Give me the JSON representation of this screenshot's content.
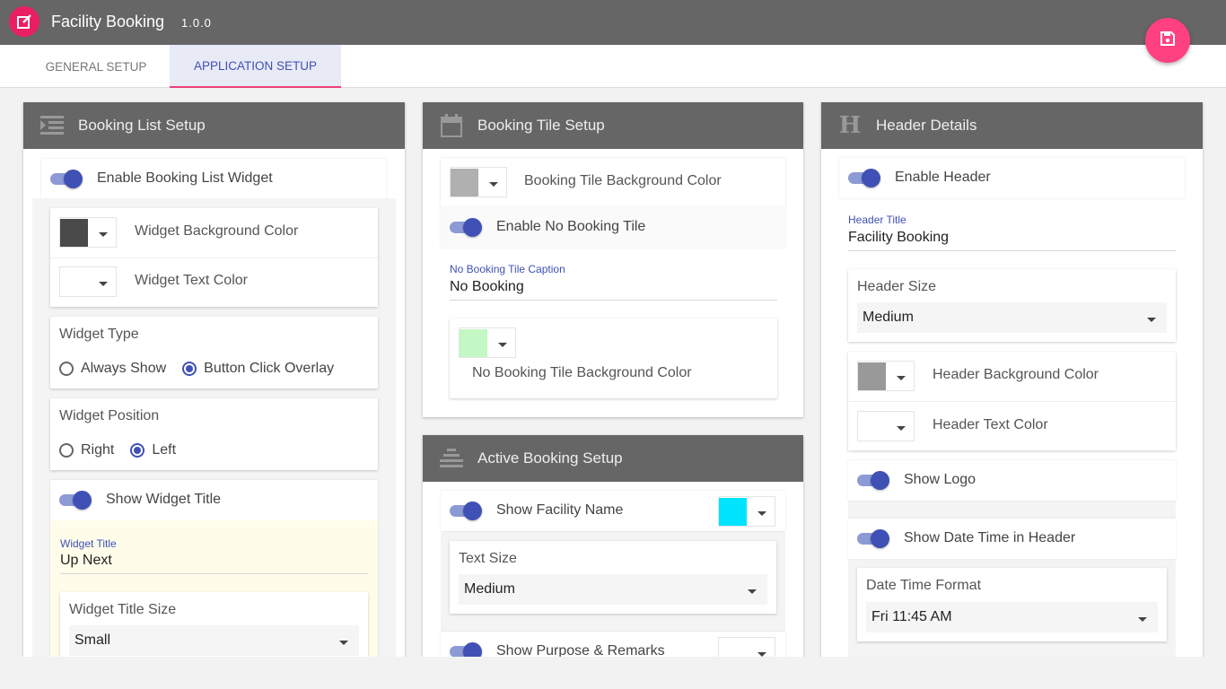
{
  "app": {
    "title": "Facility Booking",
    "version": "1.0.0",
    "logo_icon": "edit-square-icon",
    "save_icon": "save-icon"
  },
  "colors": {
    "appbar": "#666666",
    "accent": "#3f51b5",
    "fab": "#ff4081",
    "tab_indicator": "#ec407a"
  },
  "tabs": [
    {
      "label": "GENERAL SETUP",
      "active": false
    },
    {
      "label": "APPLICATION SETUP",
      "active": true
    }
  ],
  "booking_list": {
    "title": "Booking List Setup",
    "icon": "list-indent-icon",
    "enable_widget": "Enable Booking List Widget",
    "widget_bg_color_label": "Widget Background Color",
    "widget_bg_color": "#4a4a4a",
    "widget_text_color_label": "Widget Text Color",
    "widget_text_color": "#ffffff",
    "widget_type_label": "Widget Type",
    "widget_type_options": [
      "Always Show",
      "Button Click Overlay"
    ],
    "widget_type_selected": "Button Click Overlay",
    "widget_position_label": "Widget Position",
    "widget_position_options": [
      "Right",
      "Left"
    ],
    "widget_position_selected": "Left",
    "show_widget_title": "Show Widget Title",
    "widget_title_label": "Widget Title",
    "widget_title_value": "Up Next",
    "widget_title_size_label": "Widget Title Size",
    "widget_title_size_value": "Small"
  },
  "booking_tile": {
    "title": "Booking Tile Setup",
    "icon": "calendar-icon",
    "bg_color_label": "Booking Tile Background Color",
    "bg_color": "#b0b0b0",
    "enable_no_booking": "Enable No Booking Tile",
    "caption_label": "No Booking Tile Caption",
    "caption_value": "No Booking",
    "no_booking_bg_label": "No Booking Tile Background Color",
    "no_booking_bg_color": "#c3f7c3"
  },
  "active_booking": {
    "title": "Active Booking Setup",
    "icon": "stacked-lines-icon",
    "show_facility_name": "Show Facility Name",
    "facility_name_color": "#00e5ff",
    "text_size_label": "Text Size",
    "text_size_value": "Medium",
    "show_purpose": "Show Purpose & Remarks",
    "purpose_color": "#ffffff"
  },
  "header_details": {
    "title": "Header Details",
    "icon": "letter-h-icon",
    "enable_header": "Enable Header",
    "header_title_label": "Header Title",
    "header_title_value": "Facility Booking",
    "header_size_label": "Header Size",
    "header_size_value": "Medium",
    "header_bg_label": "Header Background Color",
    "header_bg_color": "#999999",
    "header_text_label": "Header Text Color",
    "header_text_color": "#ffffff",
    "show_logo": "Show Logo",
    "show_datetime": "Show Date Time in Header",
    "datetime_format_label": "Date Time Format",
    "datetime_format_value": "Fri 11:45 AM"
  }
}
